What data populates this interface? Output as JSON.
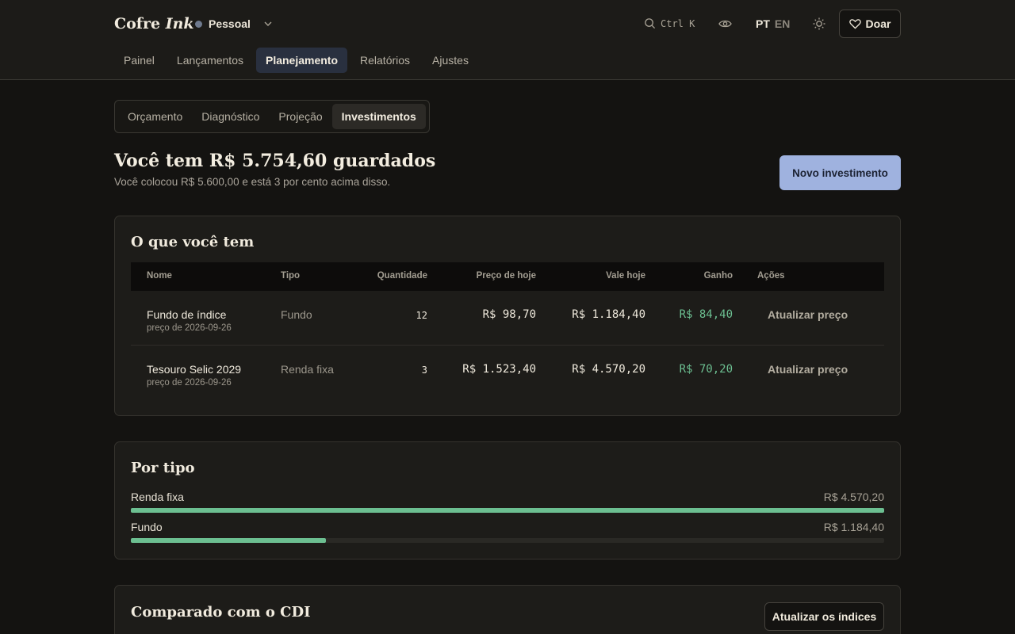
{
  "app": {
    "brand_main": "Cofre",
    "brand_accent": "Ink",
    "profile": "Pessoal",
    "search_shortcut": "Ctrl K",
    "lang_active": "PT",
    "lang_other": "EN",
    "donate": "Doar"
  },
  "nav": {
    "items": [
      "Painel",
      "Lançamentos",
      "Planejamento",
      "Relatórios",
      "Ajustes"
    ],
    "active": "Planejamento"
  },
  "subnav": {
    "items": [
      "Orçamento",
      "Diagnóstico",
      "Projeção",
      "Investimentos"
    ],
    "active": "Investimentos"
  },
  "summary": {
    "title": "Você tem R$ 5.754,60 guardados",
    "subtitle": "Você colocou R$ 5.600,00 e está 3 por cento acima disso.",
    "new_button": "Novo investimento"
  },
  "holdings": {
    "title": "O que você tem",
    "headers": {
      "name": "Nome",
      "type": "Tipo",
      "qty": "Quantidade",
      "price": "Preço de hoje",
      "value": "Vale hoje",
      "gain": "Ganho",
      "actions": "Ações"
    },
    "rows": [
      {
        "name": "Fundo de índice",
        "date": "preço de 2026-09-26",
        "type": "Fundo",
        "qty": "12",
        "price": "R$ 98,70",
        "value": "R$ 1.184,40",
        "gain": "R$ 84,40",
        "action": "Atualizar preço"
      },
      {
        "name": "Tesouro Selic 2029",
        "date": "preço de 2026-09-26",
        "type": "Renda fixa",
        "qty": "3",
        "price": "R$ 1.523,40",
        "value": "R$ 4.570,20",
        "gain": "R$ 70,20",
        "action": "Atualizar preço"
      }
    ]
  },
  "by_type": {
    "title": "Por tipo",
    "items": [
      {
        "label": "Renda fixa",
        "value": "R$ 4.570,20",
        "fraction": 1.0
      },
      {
        "label": "Fundo",
        "value": "R$ 1.184,40",
        "fraction": 0.259
      }
    ]
  },
  "cdi": {
    "title": "Comparado com o CDI",
    "button": "Atualizar os índices"
  },
  "colors": {
    "accent": "#9fb2df",
    "gain": "#6cbf91",
    "background": "#141311"
  }
}
